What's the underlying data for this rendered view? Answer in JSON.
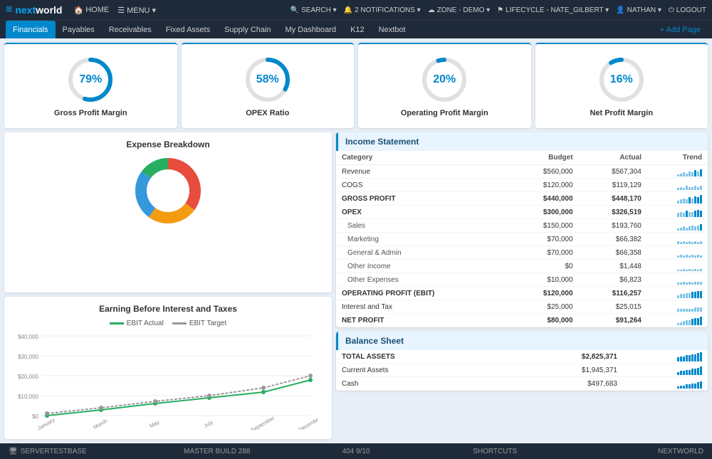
{
  "app": {
    "logo": "nextworld",
    "logo_icon": "nw"
  },
  "topnav": {
    "items": [
      {
        "label": "HOME",
        "icon": "🏠"
      },
      {
        "label": "MENU ▾",
        "icon": "☰"
      }
    ],
    "right_items": [
      {
        "label": "SEARCH ▾",
        "icon": "🔍"
      },
      {
        "label": "2 NOTIFICATIONS ▾",
        "icon": "🔔"
      },
      {
        "label": "ZONE - DEMO ▾",
        "icon": "☁"
      },
      {
        "label": "LIFECYCLE - NATE_GILBERT ▾",
        "icon": "⚑"
      },
      {
        "label": "NATHAN ▾",
        "icon": "👤"
      },
      {
        "label": "LOGOUT",
        "icon": "⏻"
      }
    ]
  },
  "tabs": {
    "items": [
      {
        "label": "Financials",
        "active": true
      },
      {
        "label": "Payables"
      },
      {
        "label": "Receivables"
      },
      {
        "label": "Fixed Assets"
      },
      {
        "label": "Supply Chain"
      },
      {
        "label": "My Dashboard"
      },
      {
        "label": "K12"
      },
      {
        "label": "Nextbot"
      }
    ],
    "add_page": "+ Add Page"
  },
  "kpis": [
    {
      "label": "Gross Profit Margin",
      "value": "79%",
      "pct": 79
    },
    {
      "label": "OPEX Ratio",
      "value": "58%",
      "pct": 58
    },
    {
      "label": "Operating Profit Margin",
      "value": "20%",
      "pct": 20
    },
    {
      "label": "Net Profit Margin",
      "value": "16%",
      "pct": 16
    }
  ],
  "expense_chart": {
    "title": "Expense Breakdown",
    "segments": [
      {
        "color": "#e74c3c",
        "pct": 35
      },
      {
        "color": "#f39c12",
        "pct": 25
      },
      {
        "color": "#3498db",
        "pct": 25
      },
      {
        "color": "#27ae60",
        "pct": 15
      }
    ]
  },
  "ebit_chart": {
    "title": "Earning Before Interest and Taxes",
    "legend": [
      {
        "label": "EBIT Actual",
        "color": "#27ae60"
      },
      {
        "label": "EBIT Target",
        "color": "#999"
      }
    ],
    "x_labels": [
      "January",
      "March",
      "May",
      "July",
      "September",
      "December"
    ],
    "y_labels": [
      "$40,000",
      "$30,000",
      "$20,000",
      "$10,000",
      "$0"
    ],
    "actual": [
      0,
      3000,
      6000,
      9000,
      12000,
      18000
    ],
    "target": [
      1000,
      4000,
      7000,
      10000,
      14000,
      20000
    ]
  },
  "income_statement": {
    "title": "Income Statement",
    "headers": [
      "Category",
      "Budget",
      "Actual",
      "Trend"
    ],
    "rows": [
      {
        "category": "Revenue",
        "budget": "$560,000",
        "actual": "$567,304",
        "bold": false,
        "indent": false,
        "trend": [
          2,
          3,
          4,
          3,
          5,
          4,
          6,
          5,
          7
        ]
      },
      {
        "category": "COGS",
        "budget": "$120,000",
        "actual": "$119,129",
        "bold": false,
        "indent": false,
        "trend": [
          2,
          3,
          2,
          4,
          3,
          3,
          4,
          3,
          4
        ]
      },
      {
        "category": "GROSS PROFIT",
        "budget": "$440,000",
        "actual": "$448,170",
        "bold": true,
        "indent": false,
        "trend": [
          3,
          4,
          5,
          4,
          6,
          5,
          7,
          6,
          8
        ]
      },
      {
        "category": "OPEX",
        "budget": "$300,000",
        "actual": "$326,519",
        "bold": true,
        "indent": false,
        "trend": [
          4,
          5,
          4,
          6,
          5,
          5,
          6,
          7,
          6
        ]
      },
      {
        "category": "Sales",
        "budget": "$150,000",
        "actual": "$193,760",
        "bold": false,
        "indent": true,
        "trend": [
          2,
          3,
          4,
          3,
          4,
          5,
          4,
          5,
          6
        ]
      },
      {
        "category": "Marketing",
        "budget": "$70,000",
        "actual": "$66,382",
        "bold": false,
        "indent": true,
        "trend": [
          3,
          2,
          3,
          2,
          3,
          2,
          3,
          2,
          3
        ]
      },
      {
        "category": "General & Admin",
        "budget": "$70,000",
        "actual": "$66,358",
        "bold": false,
        "indent": true,
        "trend": [
          2,
          3,
          2,
          3,
          2,
          3,
          2,
          3,
          2
        ]
      },
      {
        "category": "Other Income",
        "budget": "$0",
        "actual": "$1,448",
        "bold": false,
        "indent": true,
        "trend": [
          1,
          1,
          2,
          1,
          2,
          1,
          2,
          1,
          2
        ]
      },
      {
        "category": "Other Expenses",
        "budget": "$10,000",
        "actual": "$6,823",
        "bold": false,
        "indent": true,
        "trend": [
          2,
          2,
          3,
          2,
          3,
          2,
          3,
          3,
          3
        ]
      },
      {
        "category": "OPERATING PROFIT (EBIT)",
        "budget": "$120,000",
        "actual": "$116,257",
        "bold": true,
        "indent": false,
        "trend": [
          3,
          4,
          4,
          5,
          5,
          6,
          6,
          7,
          7
        ]
      },
      {
        "category": "Interest and Tax",
        "budget": "$25,000",
        "actual": "$25,015",
        "bold": false,
        "indent": false,
        "trend": [
          3,
          3,
          3,
          3,
          3,
          3,
          4,
          4,
          4
        ]
      },
      {
        "category": "NET PROFIT",
        "budget": "$80,000",
        "actual": "$91,264",
        "bold": true,
        "indent": false,
        "trend": [
          2,
          3,
          4,
          5,
          5,
          6,
          7,
          7,
          8
        ]
      }
    ]
  },
  "balance_sheet": {
    "title": "Balance Sheet",
    "rows": [
      {
        "category": "TOTAL ASSETS",
        "budget": "",
        "actual": "$2,825,371",
        "bold": true,
        "trend": [
          4,
          5,
          5,
          6,
          6,
          7,
          7,
          8,
          9
        ]
      },
      {
        "category": "Current Assets",
        "budget": "",
        "actual": "$1,945,371",
        "bold": false,
        "trend": [
          3,
          4,
          4,
          5,
          5,
          6,
          6,
          7,
          8
        ]
      },
      {
        "category": "Cash",
        "budget": "",
        "actual": "$497,683",
        "bold": false,
        "trend": [
          2,
          3,
          3,
          4,
          4,
          5,
          5,
          6,
          7
        ]
      }
    ]
  },
  "status_bar": {
    "server": "SERVERTESTBASE",
    "build": "MASTER BUILD 288",
    "page": "404 9/10",
    "shortcuts": "SHORTCUTS",
    "brand": "NEXTWORLD"
  }
}
